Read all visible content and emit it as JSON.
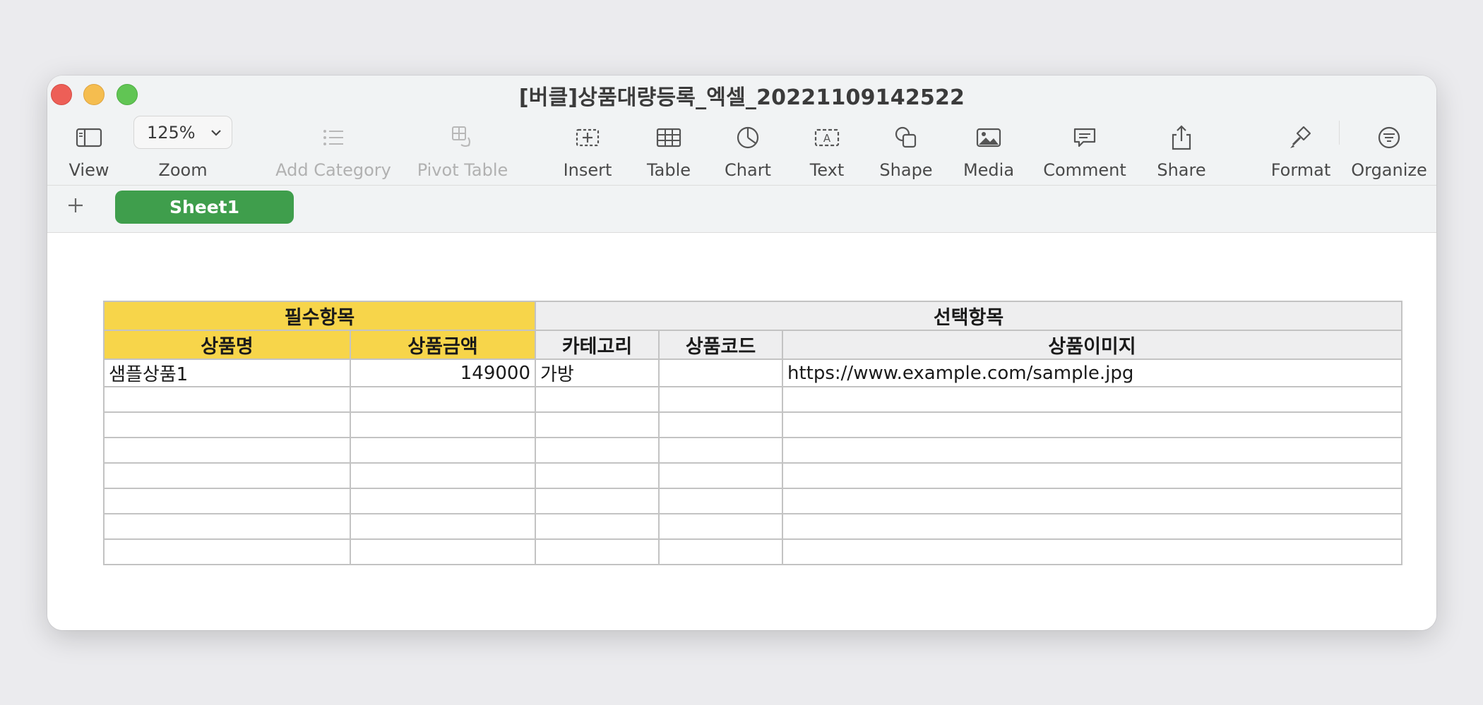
{
  "window": {
    "title": "[버클]상품대량등록_엑셀_20221109142522"
  },
  "toolbar": {
    "view": "View",
    "zoom_value": "125%",
    "zoom": "Zoom",
    "add_category": "Add Category",
    "pivot_table": "Pivot Table",
    "insert": "Insert",
    "table": "Table",
    "chart": "Chart",
    "text": "Text",
    "shape": "Shape",
    "media": "Media",
    "comment": "Comment",
    "share": "Share",
    "format": "Format",
    "organize": "Organize"
  },
  "tabs": {
    "add_symbol": "+",
    "sheets": [
      "Sheet1"
    ]
  },
  "sheet": {
    "group_headers": {
      "required": "필수항목",
      "optional": "선택항목"
    },
    "columns": [
      "상품명",
      "상품금액",
      "카테고리",
      "상품코드",
      "상품이미지"
    ],
    "rows": [
      [
        "샘플상품1",
        "149000",
        "가방",
        "",
        "https://www.example.com/sample.jpg"
      ],
      [
        "",
        "",
        "",
        "",
        ""
      ],
      [
        "",
        "",
        "",
        "",
        ""
      ],
      [
        "",
        "",
        "",
        "",
        ""
      ],
      [
        "",
        "",
        "",
        "",
        ""
      ],
      [
        "",
        "",
        "",
        "",
        ""
      ],
      [
        "",
        "",
        "",
        "",
        ""
      ],
      [
        "",
        "",
        "",
        "",
        ""
      ]
    ]
  },
  "colors": {
    "required_header": "#f7d54a",
    "optional_header": "#eeeeef",
    "sheet_tab": "#3f9e4c"
  }
}
